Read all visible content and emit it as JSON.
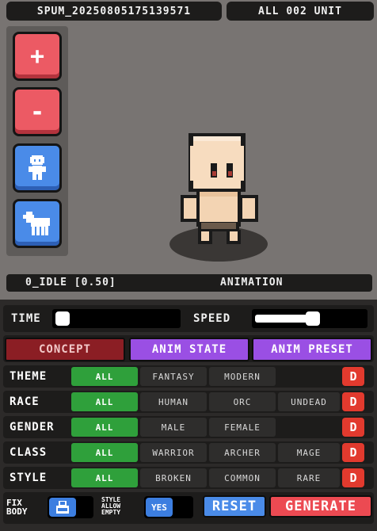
{
  "header": {
    "project_name": "SPUM_20250805175139571",
    "unit_count": "ALL 002 UNIT"
  },
  "toolbar": {
    "add_label": "+",
    "remove_label": "-",
    "buttons": [
      "add-unit-button",
      "remove-unit-button",
      "character-mode-button",
      "horse-mode-button"
    ]
  },
  "animation_bar": {
    "current": "0_IDLE [0.50]",
    "label": "ANIMATION"
  },
  "sliders": {
    "time_label": "TIME",
    "speed_label": "SPEED",
    "time_value": 0.0,
    "speed_value": 0.85
  },
  "tabs": {
    "concept": "CONCEPT",
    "anim_state": "ANIM STATE",
    "anim_preset": "ANIM PRESET"
  },
  "filters": {
    "theme": {
      "label": "THEME",
      "options": [
        "ALL",
        "FANTASY",
        "MODERN"
      ]
    },
    "race": {
      "label": "RACE",
      "options": [
        "ALL",
        "HUMAN",
        "ORC",
        "UNDEAD"
      ]
    },
    "gender": {
      "label": "GENDER",
      "options": [
        "ALL",
        "MALE",
        "FEMALE"
      ]
    },
    "class": {
      "label": "CLASS",
      "options": [
        "ALL",
        "WARRIOR",
        "ARCHER",
        "MAGE"
      ]
    },
    "style": {
      "label": "STYLE",
      "options": [
        "ALL",
        "BROKEN",
        "COMMON",
        "RARE"
      ]
    },
    "dice_label": "D"
  },
  "bottom": {
    "fix_body_line1": "FIX",
    "fix_body_line2": "BODY",
    "style_allow_line1": "STYLE",
    "style_allow_line2": "ALLOW",
    "style_allow_line3": "EMPTY",
    "style_allow_value": "YES",
    "reset_label": "RESET",
    "generate_label": "GENERATE"
  },
  "colors": {
    "bg": "#787472",
    "panel": "#1d1c1b",
    "red": "#ec5a64",
    "blue": "#4a8be8",
    "green": "#2fa03b",
    "purple": "#9a4fe4",
    "concept": "#8b1e24",
    "dice": "#e23a2e"
  }
}
